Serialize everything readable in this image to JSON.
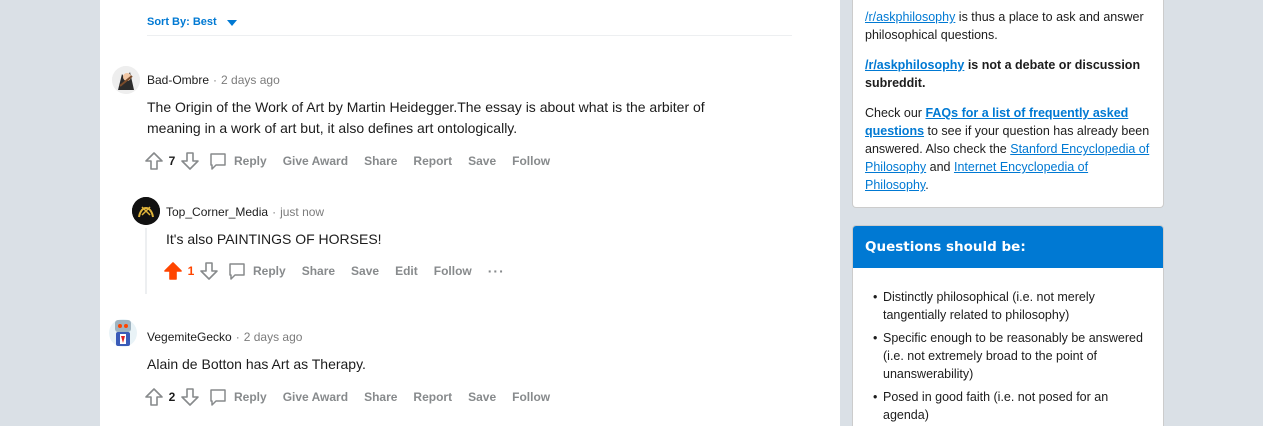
{
  "sort": {
    "label": "Sort By: Best"
  },
  "comments": [
    {
      "author": "Bad-Ombre",
      "time": "2 days ago",
      "text": "The Origin of the Work of Art by Martin Heidegger.The essay is about what is the arbiter of meaning in a work of art but, it also defines art ontologically.",
      "score": "7",
      "actions": {
        "reply": "Reply",
        "award": "Give Award",
        "share": "Share",
        "report": "Report",
        "save": "Save",
        "follow": "Follow"
      }
    },
    {
      "author": "Top_Corner_Media",
      "time": "just now",
      "text": "It's also PAINTINGS OF HORSES!",
      "score": "1",
      "actions": {
        "reply": "Reply",
        "share": "Share",
        "save": "Save",
        "edit": "Edit",
        "follow": "Follow",
        "more": "···"
      }
    },
    {
      "author": "VegemiteGecko",
      "time": "2 days ago",
      "text": "Alain de Botton has Art as Therapy.",
      "score": "2",
      "actions": {
        "reply": "Reply",
        "award": "Give Award",
        "share": "Share",
        "report": "Report",
        "save": "Save",
        "follow": "Follow"
      }
    }
  ],
  "sidebar": {
    "about": {
      "p1_link": "/r/askphilosophy",
      "p1_rest": " is thus a place to ask and answer philosophical questions.",
      "p2_link": "/r/askphilosophy",
      "p2_rest": " is not a debate or discussion subreddit.",
      "p3_pre": "Check our ",
      "p3_link1": "FAQs for a list of frequently asked questions",
      "p3_mid": " to see if your question has already been answered. Also check the ",
      "p3_link2": "Stanford Encyclopedia of Philosophy",
      "p3_and": " and ",
      "p3_link3": "Internet Encyclopedia of Philosophy",
      "p3_end": "."
    },
    "rules": {
      "title": "Questions should be:",
      "items": [
        "Distinctly philosophical (i.e. not merely tangentially related to philosophy)",
        "Specific enough to be reasonably be answered (i.e. not extremely broad to the point of unanswerability)",
        "Posed in good faith (i.e. not posed for an agenda)"
      ]
    }
  },
  "colors": {
    "accent": "#0079d3",
    "upvote": "#ff4500",
    "meta": "#878a8c",
    "page_bg": "#dae0e6"
  }
}
